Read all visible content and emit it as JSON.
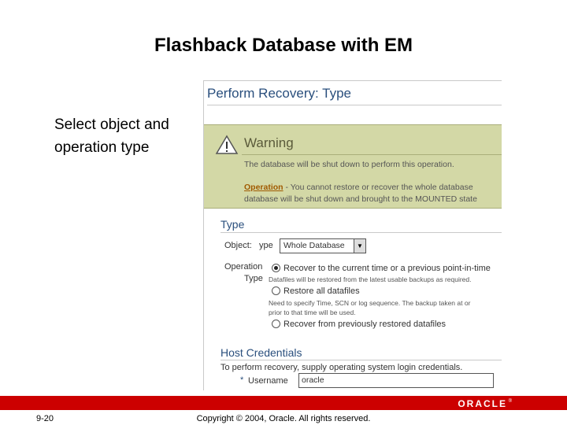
{
  "slide": {
    "title": "Flashback Database with EM",
    "callout_line1": "Select object and",
    "callout_line2": "operation type",
    "page_number": "9-20",
    "copyright": "Copyright © 2004, Oracle.  All rights reserved.",
    "logo_text": "ORACLE",
    "logo_mark": "®",
    "brand_color": "#cc0000"
  },
  "screen": {
    "title": "Perform Recovery: Type",
    "warning": {
      "icon": "warning-triangle-icon",
      "title": "Warning",
      "message": "The database will be shut down to perform this operation.",
      "operation_label": "Operation",
      "operation_text": " - You cannot restore or recover the whole database",
      "operation_text2": "database will be shut down and brought to the MOUNTED state"
    },
    "type_section": {
      "title": "Type",
      "object_label": "Object:",
      "object_select_label": "ype",
      "object_value": "Whole Database",
      "operation_label1": "Operation",
      "operation_label2": "Type",
      "options": [
        {
          "label": "Recover to the current time or a previous point-in-time",
          "hint1": "Datafiles will be restored from the latest usable backups as required.",
          "hint2": "",
          "selected": true
        },
        {
          "label": "Restore all datafiles",
          "hint1": "Need to specify Time, SCN or log sequence. The backup taken at or",
          "hint2": "prior to that time will be used.",
          "selected": false
        },
        {
          "label": "Recover from previously restored datafiles",
          "hint1": "",
          "hint2": "",
          "selected": false
        }
      ]
    },
    "credentials": {
      "title": "Host Credentials",
      "instruction": "To perform recovery, supply operating system login credentials.",
      "required_mark": "*",
      "username_label": "Username",
      "username_value": "oracle"
    }
  }
}
